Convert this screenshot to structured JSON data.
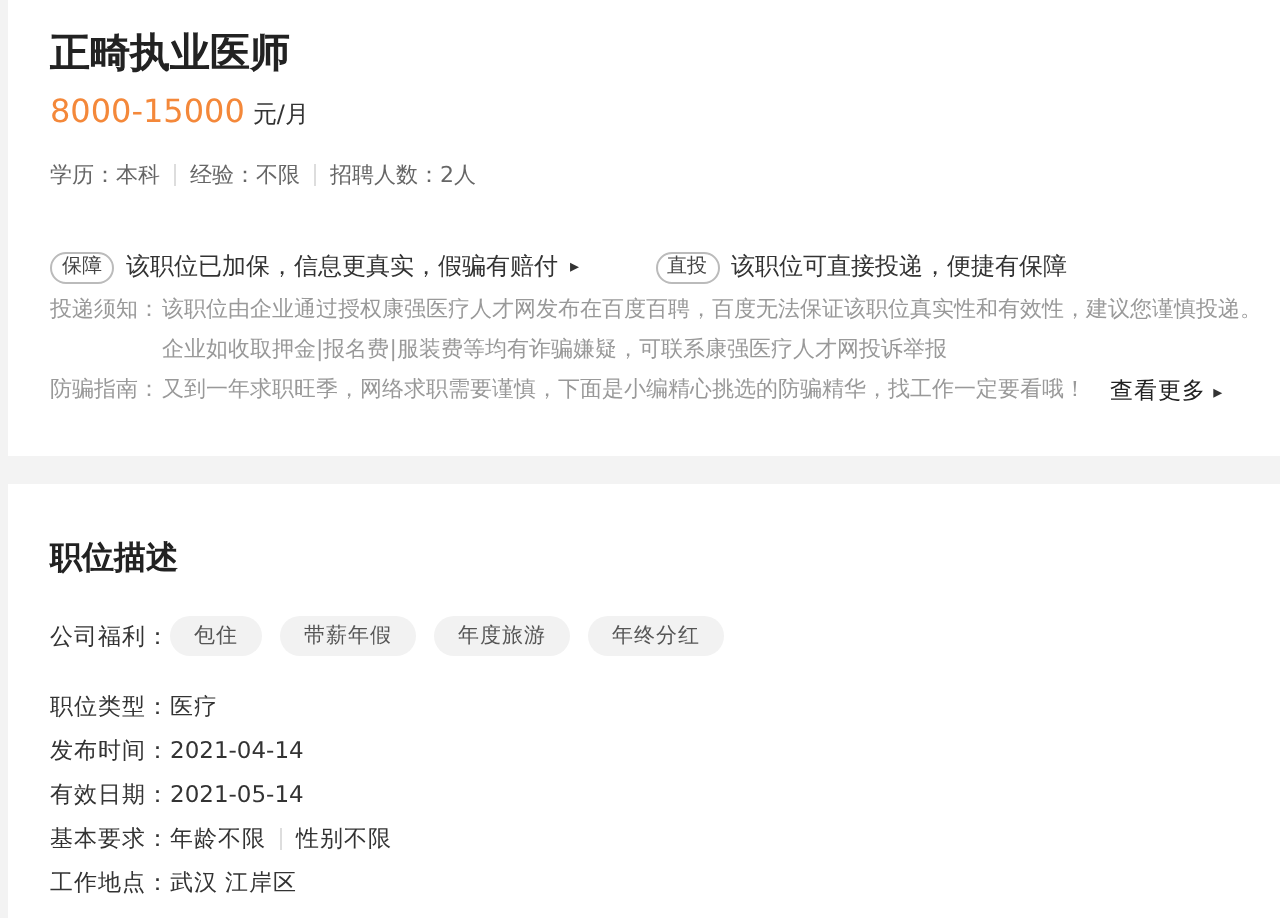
{
  "job": {
    "title": "正畸执业医师",
    "salary": "8000-15000",
    "salary_unit": "元/月",
    "meta": [
      {
        "label": "学历：",
        "value": "本科"
      },
      {
        "label": "经验：",
        "value": "不限"
      },
      {
        "label": "招聘人数：",
        "value": "2人"
      }
    ],
    "guarantees": [
      {
        "tag": "保障",
        "text": "该职位已加保，信息更真实，假骗有赔付",
        "arrow": "▸"
      },
      {
        "tag": "直投",
        "text": "该职位可直接投递，便捷有保障"
      }
    ],
    "notice": {
      "label": "投递须知：",
      "lines": [
        "该职位由企业通过授权康强医疗人才网发布在百度百聘，百度无法保证该职位真实性和有效性，建议您谨慎投递。",
        "企业如收取押金|报名费|服装费等均有诈骗嫌疑，可联系康强医疗人才网投诉举报"
      ]
    },
    "guide": {
      "label": "防骗指南：",
      "text": "又到一年求职旺季，网络求职需要谨慎，下面是小编精心挑选的防骗精华，找工作一定要看哦！",
      "more": "查看更多",
      "arrow": "▸"
    }
  },
  "description": {
    "heading": "职位描述",
    "welfare_label": "公司福利：",
    "welfare": [
      "包住",
      "带薪年假",
      "年度旅游",
      "年终分红"
    ],
    "details": [
      {
        "label": "职位类型：",
        "values": [
          "医疗"
        ]
      },
      {
        "label": "发布时间：",
        "values": [
          "2021-04-14"
        ]
      },
      {
        "label": "有效日期：",
        "values": [
          "2021-05-14"
        ]
      },
      {
        "label": "基本要求：",
        "values": [
          "年龄不限",
          "性别不限"
        ]
      },
      {
        "label": "工作地点：",
        "values": [
          "武汉 江岸区"
        ]
      }
    ]
  }
}
